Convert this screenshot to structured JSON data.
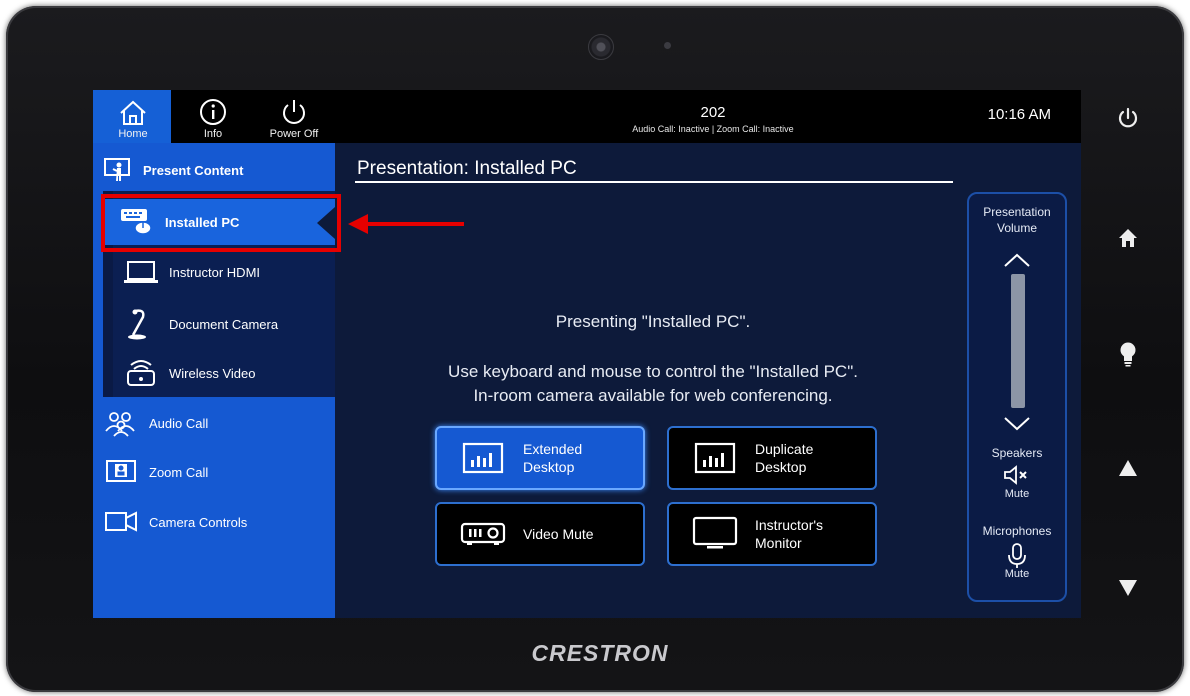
{
  "device": {
    "brand": "CRESTRON"
  },
  "topbar": {
    "home_label": "Home",
    "info_label": "Info",
    "power_label": "Power Off",
    "room_name": "202",
    "call_status": "Audio Call: Inactive | Zoom Call: Inactive",
    "time": "10:16 AM"
  },
  "sidebar": {
    "present_content": "Present Content",
    "sources": [
      {
        "label": "Installed PC",
        "icon": "keyboard-mouse-icon"
      },
      {
        "label": "Instructor HDMI",
        "icon": "laptop-icon"
      },
      {
        "label": "Document Camera",
        "icon": "document-camera-icon"
      },
      {
        "label": "Wireless Video",
        "icon": "wireless-video-icon"
      }
    ],
    "items": [
      {
        "label": "Audio Call",
        "icon": "people-icon"
      },
      {
        "label": "Zoom Call",
        "icon": "zoom-call-icon"
      },
      {
        "label": "Camera Controls",
        "icon": "video-camera-icon"
      }
    ]
  },
  "content": {
    "title": "Presentation: Installed PC",
    "message1": "Presenting \"Installed PC\".",
    "message2_line1": "Use keyboard and mouse to control the \"Installed PC\".",
    "message2_line2": "In-room camera available for web conferencing.",
    "buttons": [
      {
        "line1": "Extended",
        "line2": "Desktop",
        "active": true
      },
      {
        "line1": "Duplicate",
        "line2": "Desktop",
        "active": false
      },
      {
        "line1": "Video Mute",
        "line2": "",
        "active": false
      },
      {
        "line1": "Instructor's",
        "line2": "Monitor",
        "active": false
      }
    ]
  },
  "volume_panel": {
    "title_line1": "Presentation",
    "title_line2": "Volume",
    "speakers_label": "Speakers",
    "speakers_mute": "Mute",
    "microphones_label": "Microphones",
    "microphones_mute": "Mute"
  },
  "colors": {
    "accent_blue": "#1559d2",
    "highlight_red": "#e60000"
  }
}
